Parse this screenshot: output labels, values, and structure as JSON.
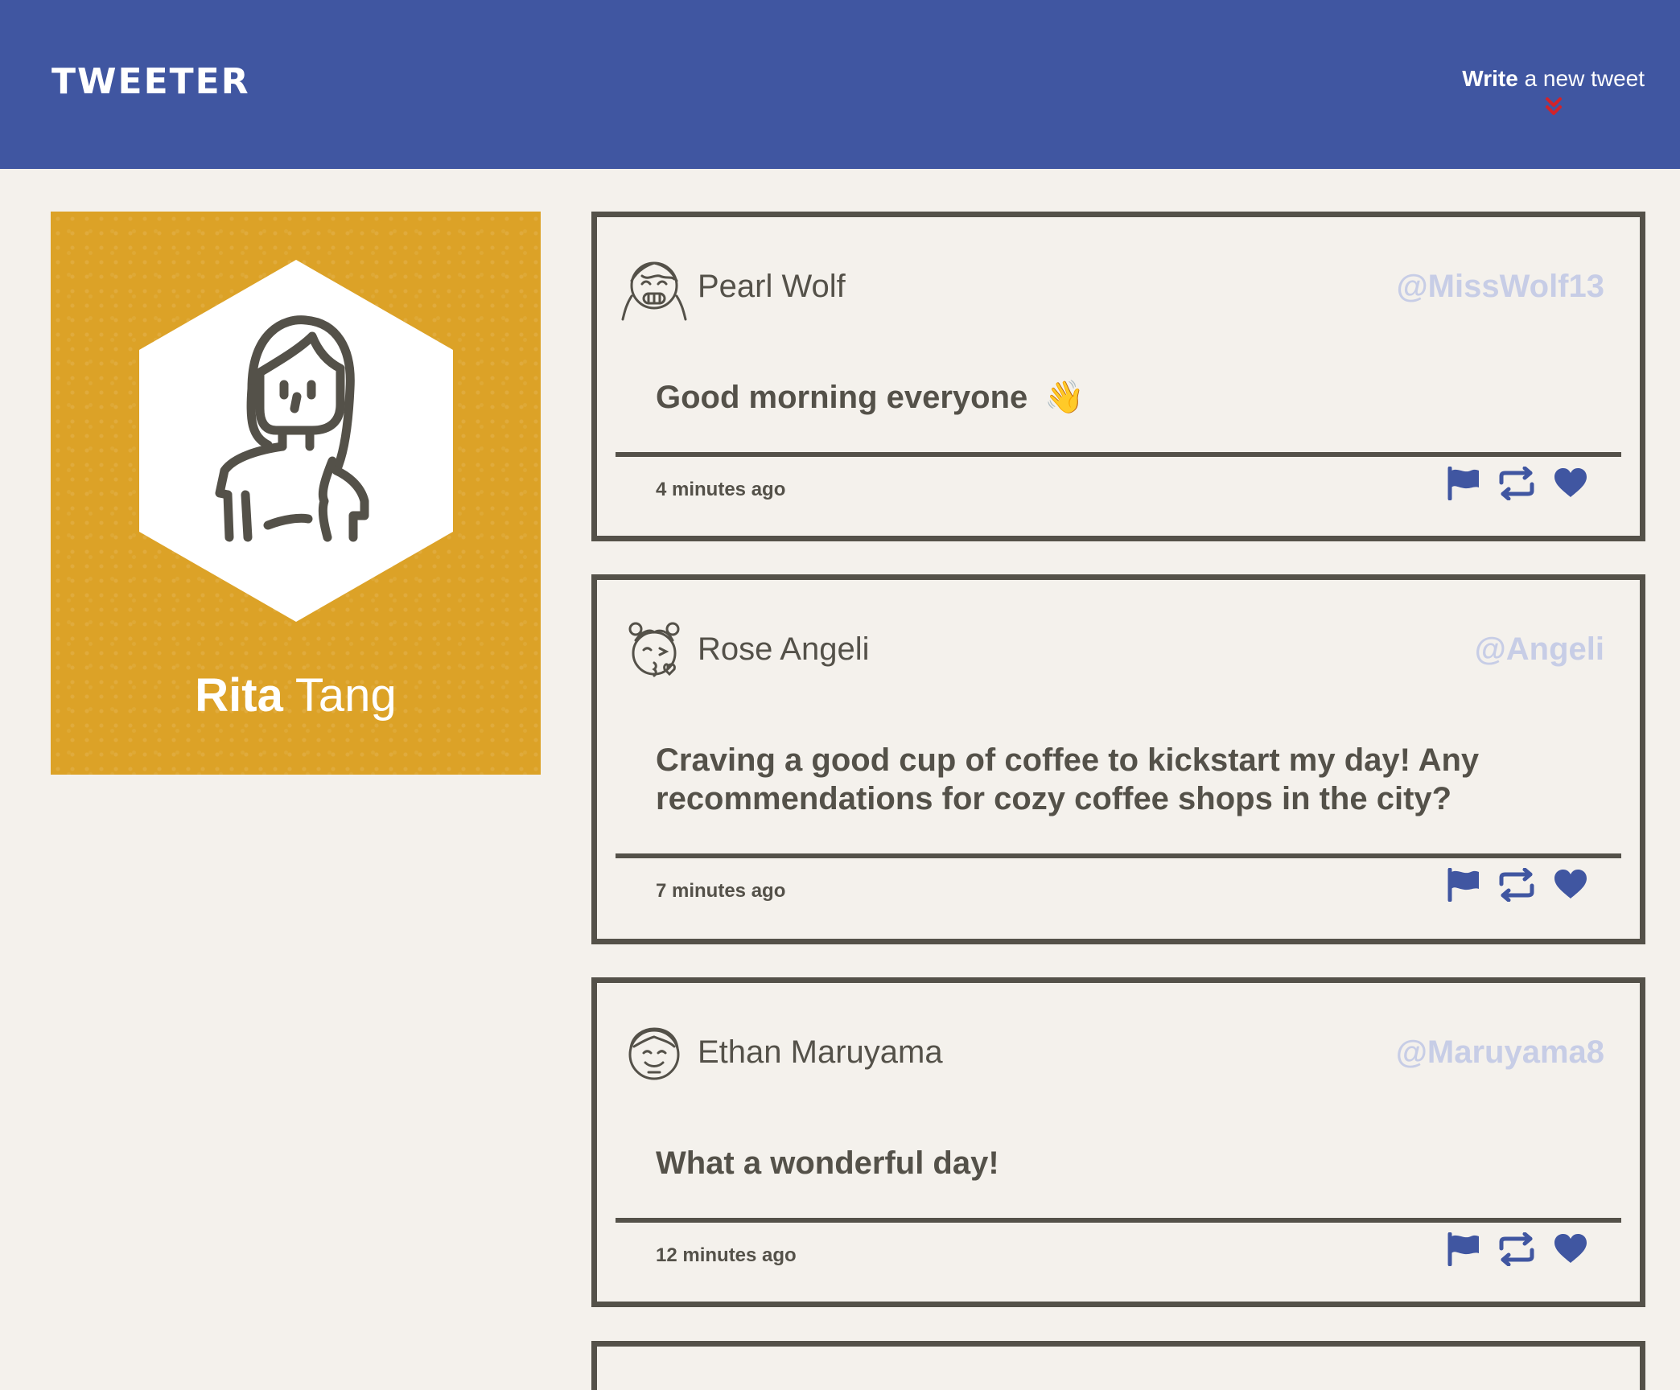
{
  "nav": {
    "logo": "TWEETER",
    "write_bold": "Write",
    "write_rest": " a new tweet"
  },
  "profile": {
    "first_name": "Rita",
    "last_name": " Tang"
  },
  "tweets": [
    {
      "name": "Pearl Wolf",
      "handle": "@MissWolf13",
      "text": "Good morning everyone",
      "emoji": "👋",
      "time": "4 minutes ago"
    },
    {
      "name": "Rose Angeli",
      "handle": "@Angeli",
      "text": "Craving a good cup of coffee to kickstart my day! Any recommendations for cozy coffee shops in the city?",
      "time": "7 minutes ago"
    },
    {
      "name": "Ethan Maruyama",
      "handle": "@Maruyama8",
      "text": "What a wonderful day!",
      "time": "12 minutes ago"
    }
  ],
  "colors": {
    "nav_bg": "#4056a1",
    "accent_red": "#d2232a",
    "profile_bg": "#dca227",
    "text_dark": "#545149",
    "handle": "#c7cde6",
    "icon_blue": "#4056a1",
    "page_bg": "#f4f1ec"
  }
}
